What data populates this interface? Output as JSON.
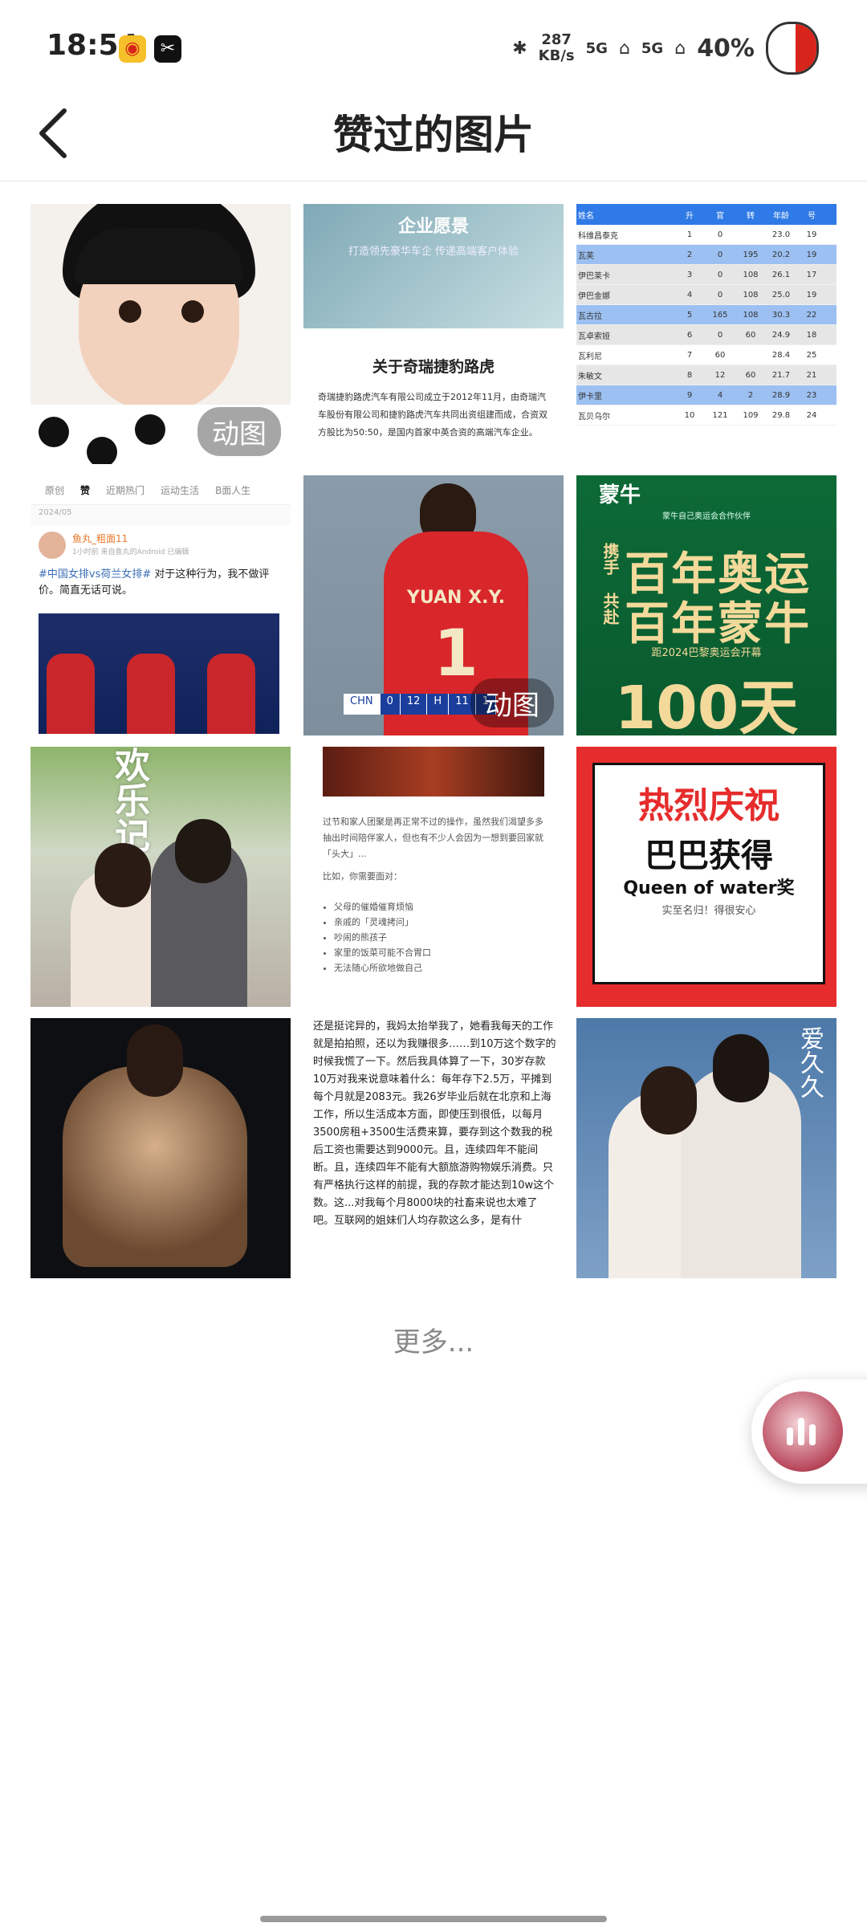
{
  "status_bar": {
    "time": "18:54",
    "speed_value": "287",
    "speed_unit": "KB/s",
    "signal1": "5G",
    "signal2": "5G",
    "battery": "40%",
    "icons": [
      "weibo-app-icon",
      "capcut-app-icon",
      "bluetooth-icon",
      "signal-icon",
      "signal-icon",
      "battery-icon"
    ]
  },
  "nav": {
    "title": "赞过的图片",
    "back_icon": "chevron-left-icon"
  },
  "tiles": {
    "gif_badge": "动图",
    "enterprise": {
      "heading": "企业愿景",
      "slogan": "打造领先豪华车企 传递高端客户体验",
      "title": "关于奇瑞捷豹路虎",
      "body": "奇瑞捷豹路虎汽车有限公司成立于2012年11月，由奇瑞汽车股份有限公司和捷豹路虎汽车共同出资组建而成，合资双方股比为50:50，是国内首家中英合资的高端汽车企业。"
    },
    "table": {
      "headers": [
        "姓名",
        "升",
        "官",
        "转",
        "",
        "年龄",
        "号"
      ],
      "rows": [
        {
          "n": "科维昌泰克",
          "v": [
            "1",
            "0",
            "",
            "23.0",
            "19"
          ]
        },
        {
          "n": "瓦芙",
          "v": [
            "2",
            "0",
            "195",
            "20.2",
            "19"
          ]
        },
        {
          "n": "伊巴莱卡",
          "v": [
            "3",
            "0",
            "108",
            "26.1",
            "17"
          ]
        },
        {
          "n": "伊巴金娜",
          "v": [
            "4",
            "0",
            "108",
            "25.0",
            "19"
          ]
        },
        {
          "n": "瓦古拉",
          "v": [
            "5",
            "165",
            "108",
            "30.3",
            "22"
          ]
        },
        {
          "n": "瓦卓索娅",
          "v": [
            "6",
            "0",
            "60",
            "24.9",
            "18"
          ]
        },
        {
          "n": "瓦利尼",
          "v": [
            "7",
            "60",
            "",
            "28.4",
            "25"
          ]
        },
        {
          "n": "朱敏文",
          "v": [
            "8",
            "12",
            "60",
            "21.7",
            "21"
          ]
        },
        {
          "n": "伊卡里",
          "v": [
            "9",
            "4",
            "2",
            "28.9",
            "23"
          ]
        },
        {
          "n": "瓦贝乌尔",
          "v": [
            "10",
            "121",
            "109",
            "29.8",
            "24"
          ]
        }
      ]
    },
    "weibo": {
      "tabs": [
        "原创",
        "赞",
        "近期热门",
        "运动生活",
        "B面人生"
      ],
      "date": "2024/05",
      "user": "鱼丸_粗面11",
      "meta": "1小时前 来自鱼丸的Android 已编辑",
      "tag": "#中国女排vs荷兰女排#",
      "text": " 对于这种行为，我不做评价。简直无话可说。"
    },
    "volley": {
      "name": "YUAN X.Y.",
      "number": "1",
      "score": [
        "CHN",
        "0",
        "12",
        "H",
        "11",
        "1"
      ]
    },
    "mengniu": {
      "brand": "蒙牛",
      "sub": "蒙牛自己奥运会合作伙伴",
      "line1_small": "携手",
      "line1": "百年奥运",
      "line2_small": "共赴",
      "line2": "百年蒙牛",
      "bar": "距2024巴黎奥运会开幕",
      "days": "100天"
    },
    "drama": {
      "title": "欢乐记"
    },
    "article": {
      "para1": "过节和家人团聚是再正常不过的操作，虽然我们渴望多多抽出时间陪伴家人，但也有不少人会因为一想到要回家就「头大」...",
      "para2": "比如，你需要面对：",
      "items": [
        "父母的催婚催育烦恼",
        "亲戚的「灵魂拷问」",
        "吵闹的熊孩子",
        "家里的饭菜可能不合胃口",
        "无法随心所欲地做自己"
      ]
    },
    "celebration": {
      "line1": "热烈庆祝",
      "line2": "巴巴获得",
      "line3": "Queen of water奖",
      "line4": "实至名归！得很安心"
    },
    "longtext": {
      "text": "还是挺诧异的，我妈太抬举我了，她看我每天的工作就是拍拍照，还以为我赚很多……到10万这个数字的时候我慌了一下。然后我具体算了一下，30岁存款10万对我来说意味着什么：每年存下2.5万，平摊到每个月就是2083元。我26岁毕业后就在北京和上海工作，所以生活成本方面，即使压到很低，以每月3500房租+3500生活费来算，要存到这个数我的税后工资也需要达到9000元。且，连续四年不能间断。且，连续四年不能有大额旅游购物娱乐消费。只有严格执行这样的前提，我的存款才能达到10w这个数。这...对我每个月8000块的社畜来说也太难了吧。互联网的姐妹们人均存款这么多，是有什"
    },
    "couple": {
      "title": "爱久久"
    }
  },
  "more": "更多...",
  "float_player": {
    "icon": "music-pause-icon"
  }
}
